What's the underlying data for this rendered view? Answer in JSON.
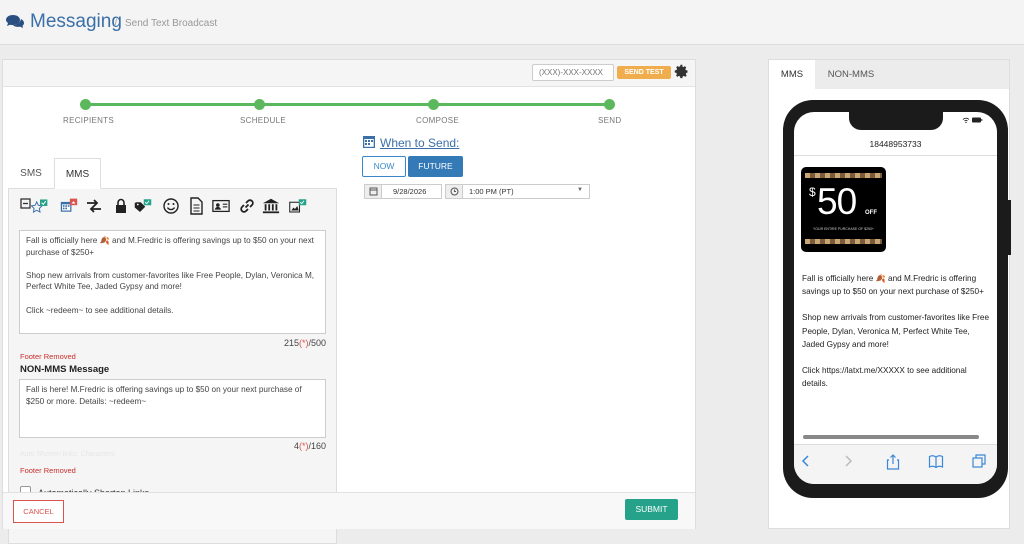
{
  "header": {
    "title": "Messaging",
    "separator": "/",
    "breadcrumb": "Send Text Broadcast"
  },
  "test_send": {
    "phone_placeholder": "(XXX)-XXX-XXXX",
    "send_test_label": "SEND TEST"
  },
  "steps": [
    {
      "label": "RECIPIENTS"
    },
    {
      "label": "SCHEDULE"
    },
    {
      "label": "COMPOSE"
    },
    {
      "label": "SEND"
    }
  ],
  "message_tabs": [
    {
      "label": "SMS",
      "active": false
    },
    {
      "label": "MMS",
      "active": true
    }
  ],
  "toolbar_icons": [
    "collapse-icon",
    "favorite-star-icon",
    "calendar-icon",
    "shuffle-icon",
    "lock-icon",
    "tag-icon",
    "emoji-icon",
    "document-icon",
    "contact-card-icon",
    "link-icon",
    "bank-icon",
    "image-icon"
  ],
  "mms_message": {
    "text": "Fall is officially here 🍂 and M.Fredric is offering savings up to $50 on your next purchase of $250+\n\nShop new arrivals from customer-favorites like Free People, Dylan, Veronica M, Perfect White Tee, Jaded Gypsy and more!\n\nClick ~redeem~ to see additional details.",
    "count": "215",
    "count_marker": "(*)",
    "count_max": "/500",
    "footer_note": "Footer Removed"
  },
  "non_mms": {
    "title": "NON-MMS Message",
    "text": "Fall is here! M.Fredric is offering savings up to $50 on your next purchase of $250 or more. Details: ~redeem~",
    "count": "4",
    "count_marker": "(*)",
    "count_max": "/160",
    "faded_note": "Auto Shorten links: Characters",
    "footer_note": "Footer Removed"
  },
  "shorten_links": {
    "label": "Automatically Shorten Links",
    "checked": false
  },
  "schedule": {
    "title": "When to Send:",
    "now_label": "NOW",
    "future_label": "FUTURE",
    "date": "9/28/2026",
    "time": "1:00 PM (PT)"
  },
  "actions": {
    "cancel_label": "CANCEL",
    "submit_label": "SUBMIT"
  },
  "preview": {
    "tabs": [
      {
        "label": "MMS",
        "active": true
      },
      {
        "label": "NON-MMS",
        "active": false
      }
    ],
    "phone_number": "18448953733",
    "coupon": {
      "dollar": "$",
      "amount": "50",
      "off": "OFF",
      "fine_print": "YOUR ENTIRE PURCHASE OF $250+"
    },
    "paragraphs": [
      "Fall is officially here 🍂 and M.Fredric is offering savings up to $50 on your next purchase of $250+",
      "Shop new arrivals from customer-favorites like Free People, Dylan, Veronica M, Perfect White Tee, Jaded Gypsy and more!",
      "Click https://latxt.me/XXXXX to see additional details."
    ]
  },
  "colors": {
    "brand_blue": "#3a6fa8",
    "step_green": "#5cb85c",
    "send_test_orange": "#f0ad4e",
    "submit_teal": "#26a28a",
    "cancel_red": "#d9534f"
  }
}
